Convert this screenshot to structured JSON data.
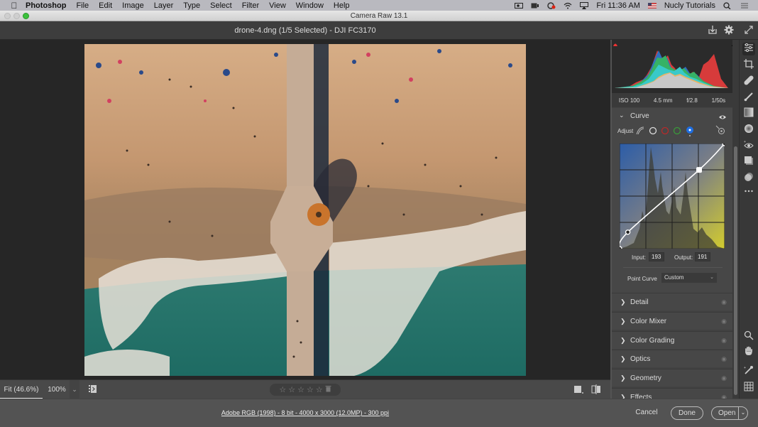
{
  "menubar": {
    "app_name": "Photoshop",
    "items": [
      "File",
      "Edit",
      "Image",
      "Layer",
      "Type",
      "Select",
      "Filter",
      "View",
      "Window",
      "Help"
    ],
    "clock": "Fri 11:36 AM",
    "user": "Nucly Tutorials"
  },
  "window": {
    "title": "Camera Raw 13.1",
    "file_label": "drone-4.dng (1/5 Selected)  -  DJI FC3170"
  },
  "histogram": {
    "exif": {
      "iso": "ISO 100",
      "focal": "4.5 mm",
      "aperture": "f/2.8",
      "shutter": "1/50s"
    }
  },
  "curve": {
    "title": "Curve",
    "adjust_label": "Adjust",
    "channels": [
      "parametric",
      "rgb",
      "red",
      "green",
      "blue"
    ],
    "selected_channel": "blue",
    "input_label": "Input:",
    "input_value": "193",
    "output_label": "Output:",
    "output_value": "191",
    "point_curve_label": "Point Curve",
    "point_curve_value": "Custom",
    "points": [
      [
        0,
        0
      ],
      [
        20,
        40
      ],
      [
        193,
        191
      ],
      [
        255,
        255
      ]
    ],
    "colors": {
      "top_left": "#2c5da8",
      "bottom_right": "#d3cc2e"
    }
  },
  "sections": [
    {
      "label": "Detail"
    },
    {
      "label": "Color Mixer"
    },
    {
      "label": "Color Grading"
    },
    {
      "label": "Optics"
    },
    {
      "label": "Geometry"
    },
    {
      "label": "Effects"
    }
  ],
  "bottom": {
    "fit_label": "Fit (46.6%)",
    "zoom_100": "100%",
    "stars": [
      "☆",
      "☆",
      "☆",
      "☆",
      "☆"
    ]
  },
  "footer": {
    "info": "Adobe RGB (1998) - 8 bit - 4000 x 3000 (12.0MP) - 300 ppi",
    "cancel": "Cancel",
    "done": "Done",
    "open": "Open"
  }
}
